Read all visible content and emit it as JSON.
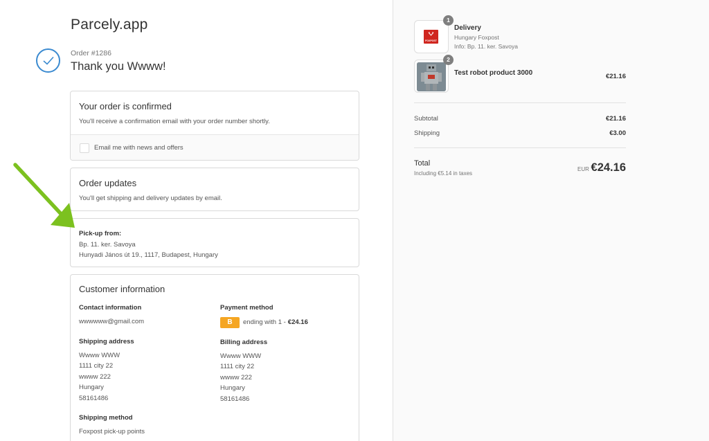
{
  "store": {
    "name": "Parcely.app"
  },
  "order": {
    "number": "Order #1286",
    "thanks": "Thank you Wwww!"
  },
  "confirmed": {
    "title": "Your order is confirmed",
    "text": "You'll receive a confirmation email with your order number shortly.",
    "newsletter_label": "Email me with news and offers"
  },
  "updates": {
    "title": "Order updates",
    "text": "You'll get shipping and delivery updates by email."
  },
  "pickup": {
    "title": "Pick-up from:",
    "line1": "Bp. 11. ker. Savoya",
    "line2": "Hunyadi János út 19., 1117, Budapest, Hungary"
  },
  "customer": {
    "title": "Customer information",
    "contact_heading": "Contact information",
    "email": "wwwwww@gmail.com",
    "payment_heading": "Payment method",
    "payment_badge": "B",
    "payment_text": "ending with 1 -",
    "payment_amount": "€24.16",
    "shipping_heading": "Shipping address",
    "shipping_lines": [
      "Wwww WWW",
      "1111 city 22",
      "wwww 222",
      "Hungary",
      "58161486"
    ],
    "billing_heading": "Billing address",
    "billing_lines": [
      "Wwww WWW",
      "1111 city 22",
      "wwww 222",
      "Hungary",
      "58161486"
    ],
    "method_heading": "Shipping method",
    "method_text": "Foxpost pick-up points"
  },
  "items": [
    {
      "qty": "1",
      "name": "Delivery",
      "sub1": "Hungary Foxpost",
      "sub2": "Info: Bp. 11. ker. Savoya",
      "logo_text": "FOXPOST",
      "brand_color": "#d0261f"
    },
    {
      "qty": "2",
      "name": "Test robot product 3000",
      "price": "€21.16"
    }
  ],
  "summary": {
    "subtotal_label": "Subtotal",
    "subtotal": "€21.16",
    "shipping_label": "Shipping",
    "shipping": "€3.00",
    "total_label": "Total",
    "tax_note": "Including €5.14 in taxes",
    "currency": "EUR",
    "total": "€24.16"
  },
  "colors": {
    "accent": "#3a8ad0",
    "arrow": "#7cc11f",
    "badge": "#f5a623"
  }
}
